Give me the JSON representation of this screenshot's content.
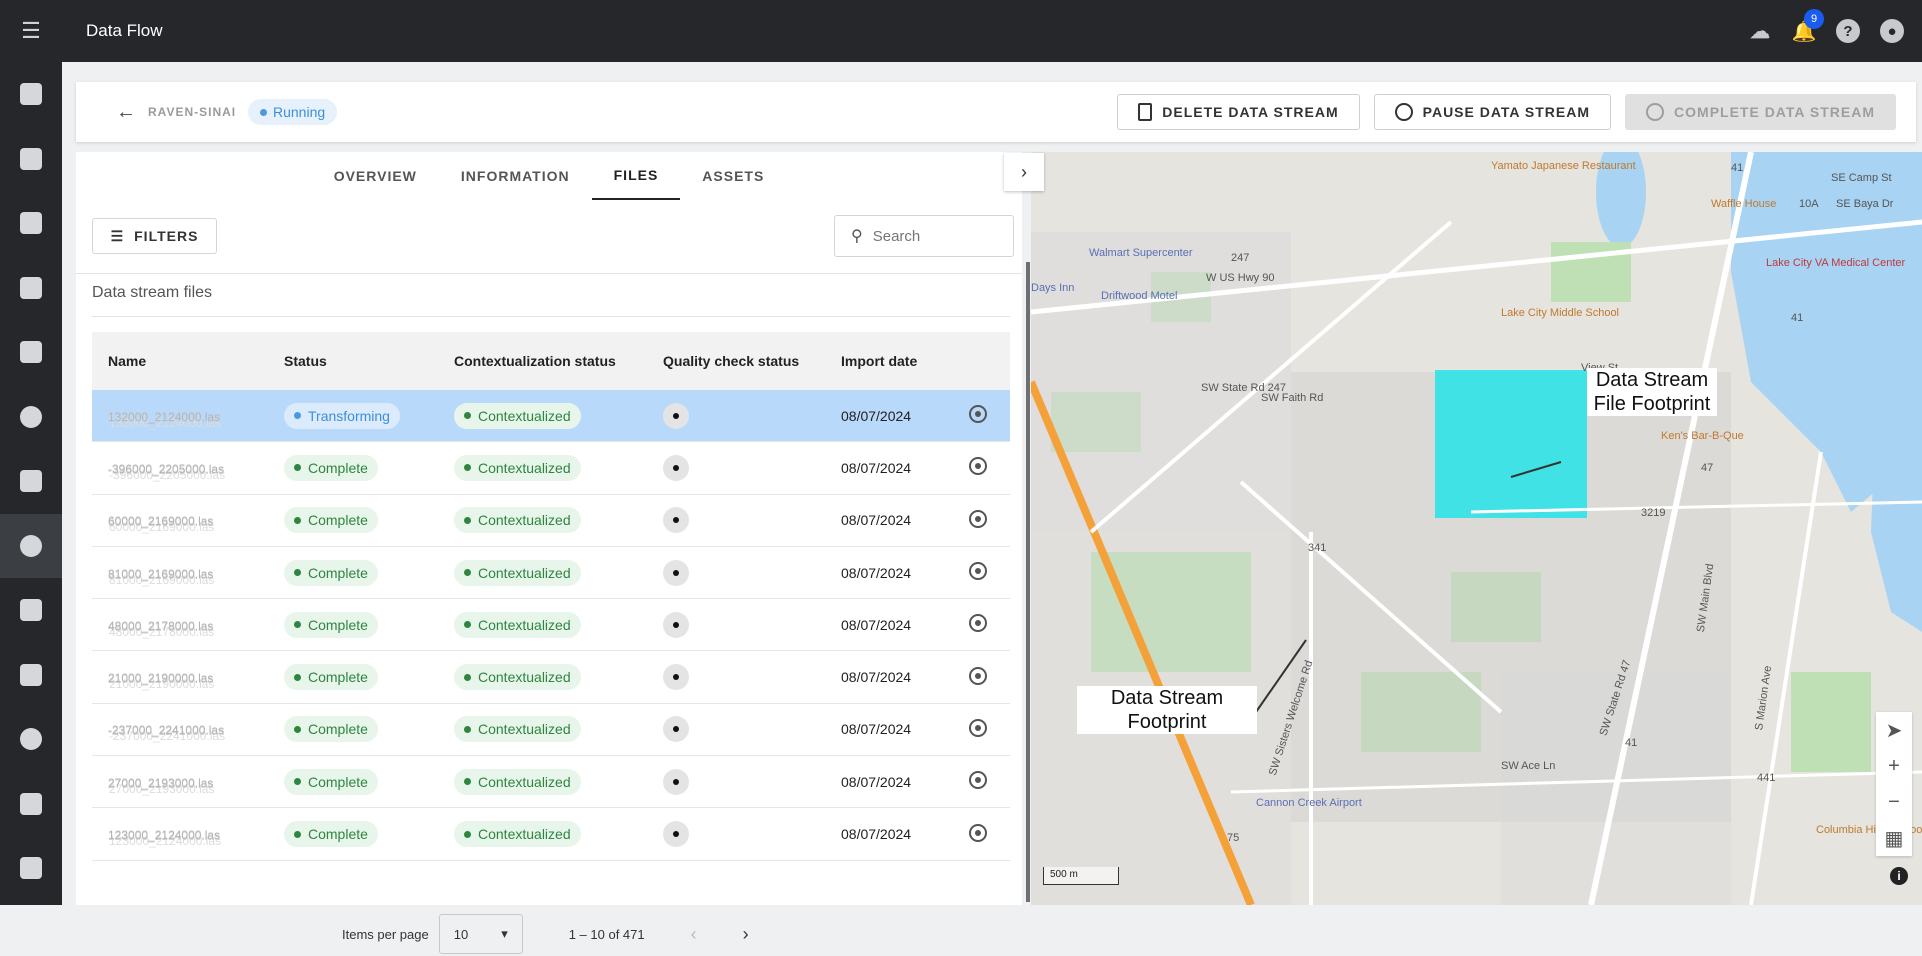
{
  "app": {
    "title": "Data Flow",
    "notification_count": "9"
  },
  "sidebar": {
    "items": [
      "tablet",
      "feed",
      "calendar",
      "scan",
      "checklist",
      "search-data",
      "briefcase",
      "data-flow",
      "filter",
      "list",
      "settings",
      "clipboard",
      "clipboard-2"
    ]
  },
  "header": {
    "stream_name": "RAVEN-SINAI",
    "status": "Running",
    "delete_label": "DELETE DATA STREAM",
    "pause_label": "PAUSE DATA STREAM",
    "complete_label": "COMPLETE DATA STREAM"
  },
  "tabs": [
    {
      "label": "OVERVIEW",
      "active": false
    },
    {
      "label": "INFORMATION",
      "active": false
    },
    {
      "label": "FILES",
      "active": true
    },
    {
      "label": "ASSETS",
      "active": false
    }
  ],
  "toolbar": {
    "filters_label": "FILTERS",
    "search_placeholder": "Search"
  },
  "files": {
    "section_title": "Data stream files",
    "columns": [
      "Name",
      "Status",
      "Contextualization status",
      "Quality check status",
      "Import date"
    ],
    "rows": [
      {
        "name": "132000_2124000.las",
        "status": "Transforming",
        "ctx": "Contextualized",
        "date": "08/07/2024",
        "selected": true
      },
      {
        "name": "-396000_2205000.las",
        "status": "Complete",
        "ctx": "Contextualized",
        "date": "08/07/2024",
        "selected": false
      },
      {
        "name": "60000_2169000.las",
        "status": "Complete",
        "ctx": "Contextualized",
        "date": "08/07/2024",
        "selected": false
      },
      {
        "name": "81000_2169000.las",
        "status": "Complete",
        "ctx": "Contextualized",
        "date": "08/07/2024",
        "selected": false
      },
      {
        "name": "48000_2178000.las",
        "status": "Complete",
        "ctx": "Contextualized",
        "date": "08/07/2024",
        "selected": false
      },
      {
        "name": "21000_2190000.las",
        "status": "Complete",
        "ctx": "Contextualized",
        "date": "08/07/2024",
        "selected": false
      },
      {
        "name": "-237000_2241000.las",
        "status": "Complete",
        "ctx": "Contextualized",
        "date": "08/07/2024",
        "selected": false
      },
      {
        "name": "27000_2193000.las",
        "status": "Complete",
        "ctx": "Contextualized",
        "date": "08/07/2024",
        "selected": false
      },
      {
        "name": "123000_2124000.las",
        "status": "Complete",
        "ctx": "Contextualized",
        "date": "08/07/2024",
        "selected": false
      }
    ]
  },
  "pagination": {
    "items_per_page_label": "Items per page",
    "per_page": "10",
    "range": "1 – 10 of 471"
  },
  "map": {
    "labels": {
      "yamato": "Yamato Japanese Restaurant",
      "walmart": "Walmart Supercenter",
      "us90": "W US Hwy 90",
      "days_inn": "Days Inn",
      "driftwood": "Driftwood Motel",
      "lake_city_ms": "Lake City Middle School",
      "waffle": "Waffle House",
      "se_camp": "SE Camp St",
      "se_baya": "SE Baya Dr",
      "va_center": "Lake City VA Medical Center",
      "sw_state_247": "SW State Rd 247",
      "sw_faith": "SW Faith Rd",
      "kens": "Ken's Bar-B-Que",
      "r3219": "3219",
      "r47": "47",
      "r41a": "41",
      "r41b": "41",
      "r41c": "41",
      "r441": "441",
      "r247": "247",
      "r341": "341",
      "r75": "75",
      "r10a": "10A",
      "sisters": "SW Sisters Welcome Rd",
      "sw_state_47": "SW State Rd 47",
      "sw_main": "SW Main Blvd",
      "s_marion": "S Marion Ave",
      "ace_ln": "SW Ace Ln",
      "cannon": "Cannon Creek Airport",
      "columbia": "Columbia High School",
      "view_st": "View St"
    },
    "callout_file": "Data Stream File Footprint",
    "callout_stream": "Data Stream Footprint",
    "scale": "500 m",
    "info": "i",
    "colors": {
      "footprint": "#25e3e8",
      "highway": "#f5a13a",
      "water": "#a8d3f2",
      "park": "#bfe0b5"
    }
  }
}
